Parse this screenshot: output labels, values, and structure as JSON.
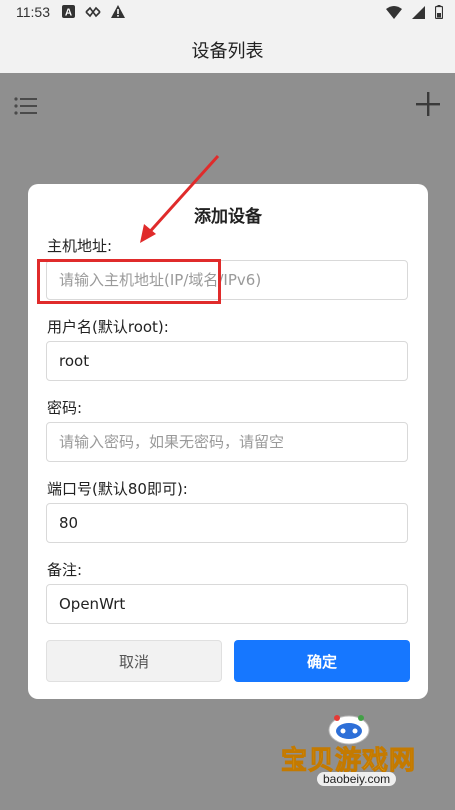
{
  "status_bar": {
    "time": "11:53",
    "icons_left": [
      "a-badge-icon",
      "link-icon",
      "warning-icon"
    ],
    "icons_right": [
      "wifi-icon",
      "cellular-icon",
      "battery-icon"
    ]
  },
  "app_bar": {
    "title": "设备列表",
    "left_icon": "list-menu-icon",
    "right_icon": "add-icon"
  },
  "dialog": {
    "title": "添加设备",
    "fields": [
      {
        "label": "主机地址:",
        "value": "",
        "placeholder": "请输入主机地址(IP/域名/IPv6)"
      },
      {
        "label": "用户名(默认root):",
        "value": "root",
        "placeholder": ""
      },
      {
        "label": "密码:",
        "value": "",
        "placeholder": "请输入密码，如果无密码，请留空"
      },
      {
        "label": "端口号(默认80即可):",
        "value": "80",
        "placeholder": ""
      },
      {
        "label": "备注:",
        "value": "OpenWrt",
        "placeholder": ""
      }
    ],
    "cancel_label": "取消",
    "confirm_label": "确定"
  },
  "annotation": {
    "color": "#e02b2b"
  },
  "watermark": {
    "text": "宝贝游戏网",
    "url": "baobeiy.com"
  },
  "colors": {
    "primary": "#1677ff",
    "overlay": "#8f8f8f"
  }
}
